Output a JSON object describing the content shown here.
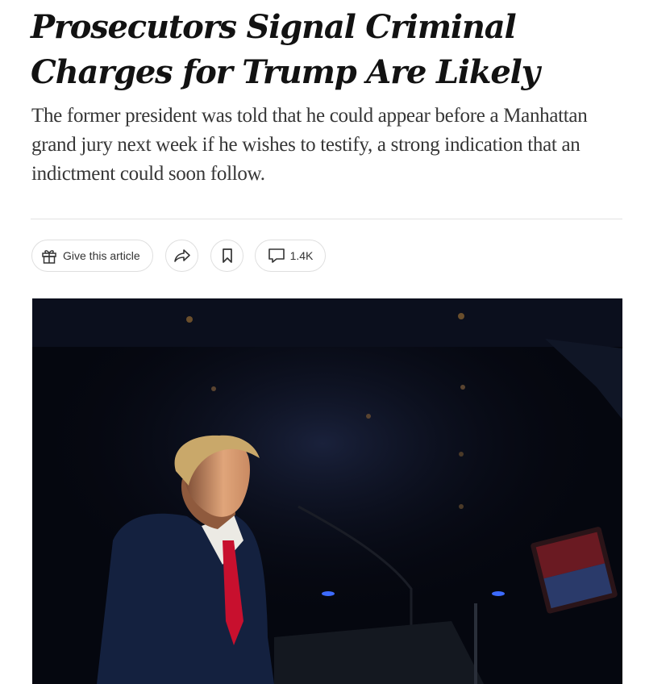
{
  "article": {
    "headline": "Prosecutors Signal Criminal Charges for Trump Are Likely",
    "summary": "The former president was told that he could appear before a Manhattan grand jury next week if he wishes to testify, a strong indication that an indictment could soon follow."
  },
  "toolbar": {
    "gift_label": "Give this article",
    "gift_icon": "gift-icon",
    "share_icon": "share-icon",
    "save_icon": "bookmark-icon",
    "comments_icon": "comment-icon",
    "comments_count": "1.4K"
  },
  "colors": {
    "text": "#121212",
    "summary_text": "#363636",
    "photo_background": "#05070f",
    "tie": "#c8102e"
  }
}
